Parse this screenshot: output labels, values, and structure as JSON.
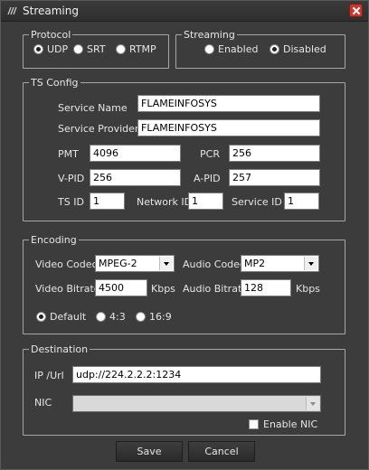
{
  "window": {
    "title": "Streaming"
  },
  "protocol": {
    "legend": "Protocol",
    "options": [
      {
        "label": "UDP",
        "checked": true
      },
      {
        "label": "SRT",
        "checked": false
      },
      {
        "label": "RTMP",
        "checked": false
      }
    ]
  },
  "streaming": {
    "legend": "Streaming",
    "options": [
      {
        "label": "Enabled",
        "checked": false
      },
      {
        "label": "Disabled",
        "checked": true
      }
    ]
  },
  "ts_config": {
    "legend": "TS Config",
    "service_name": {
      "label": "Service Name",
      "value": "FLAMEINFOSYS"
    },
    "service_provider": {
      "label": "Service Provider",
      "value": "FLAMEINFOSYS"
    },
    "pmt": {
      "label": "PMT",
      "value": "4096"
    },
    "pcr": {
      "label": "PCR",
      "value": "256"
    },
    "vpid": {
      "label": "V-PID",
      "value": "256"
    },
    "apid": {
      "label": "A-PID",
      "value": "257"
    },
    "ts_id": {
      "label": "TS ID",
      "value": "1"
    },
    "network_id": {
      "label": "Network ID",
      "value": "1"
    },
    "service_id": {
      "label": "Service ID",
      "value": "1"
    }
  },
  "encoding": {
    "legend": "Encoding",
    "video_codec": {
      "label": "Video Codec",
      "value": "MPEG-2"
    },
    "audio_codec": {
      "label": "Audio Codec",
      "value": "MP2"
    },
    "video_bitrate": {
      "label": "Video Bitrate",
      "value": "4500",
      "unit": "Kbps"
    },
    "audio_bitrate": {
      "label": "Audio Bitrate",
      "value": "128",
      "unit": "Kbps"
    },
    "aspect": [
      {
        "label": "Default",
        "checked": true
      },
      {
        "label": "4:3",
        "checked": false
      },
      {
        "label": "16:9",
        "checked": false
      }
    ]
  },
  "destination": {
    "legend": "Destination",
    "ip_url": {
      "label": "IP /Url",
      "value": "udp://224.2.2.2:1234"
    },
    "nic": {
      "label": "NIC",
      "value": ""
    },
    "enable_nic": {
      "label": "Enable NIC",
      "checked": false
    }
  },
  "buttons": {
    "save": "Save",
    "cancel": "Cancel"
  }
}
